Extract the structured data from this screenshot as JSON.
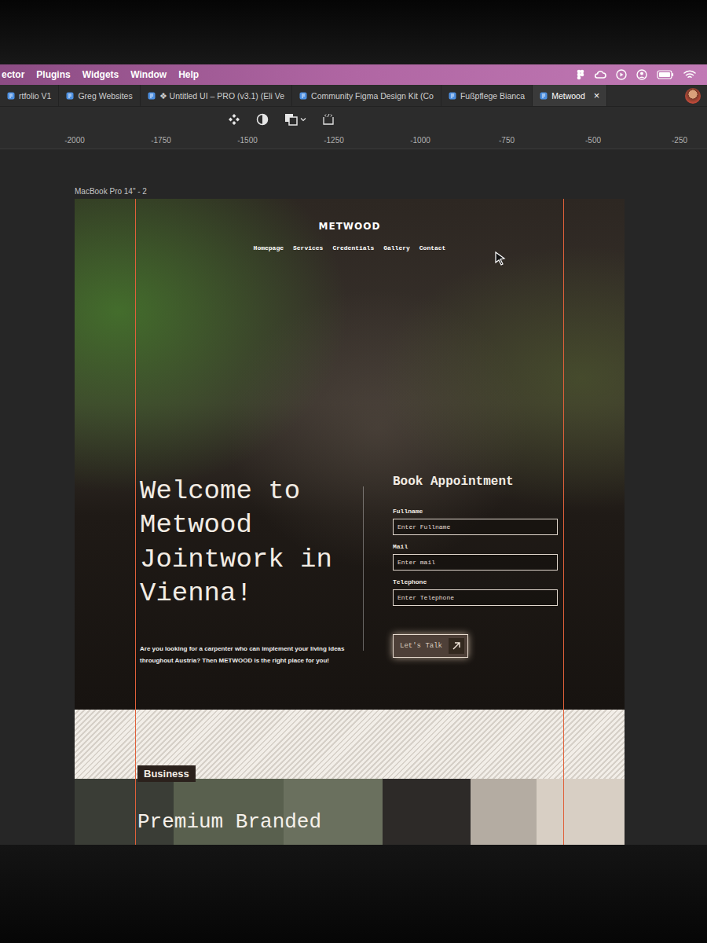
{
  "menu_bar": {
    "items": [
      "ector",
      "Plugins",
      "Widgets",
      "Window",
      "Help"
    ]
  },
  "tabs": [
    {
      "label": "rtfolio V1",
      "selected": false
    },
    {
      "label": "Greg Websites",
      "selected": false
    },
    {
      "label": "❖ Untitled UI – PRO (v3.1) (Eli Ve",
      "selected": false
    },
    {
      "label": "Community Figma Design Kit (Co",
      "selected": false
    },
    {
      "label": "Fußpflege Bianca",
      "selected": false
    },
    {
      "label": "Metwood",
      "selected": true,
      "close": "×"
    }
  ],
  "ruler": {
    "ticks": [
      "-2000",
      "-1750",
      "-1500",
      "-1250",
      "-1000",
      "-750",
      "-500",
      "-250"
    ]
  },
  "frame": {
    "label": "MacBook Pro 14\" - 2"
  },
  "site": {
    "logo": "METWOOD",
    "nav": [
      "Homepage",
      "Services",
      "Credentials",
      "Gallery",
      "Contact"
    ],
    "hero": {
      "title": "Welcome to Metwood Jointwork in Vienna!",
      "text": "Are you looking for a carpenter who can implement your living ideas throughout Austria? Then METWOOD is the right place for you!"
    },
    "form": {
      "title": "Book Appointment",
      "fields": [
        {
          "label": "Fullname",
          "placeholder": "Enter Fullname"
        },
        {
          "label": "Mail",
          "placeholder": "Enter mail"
        },
        {
          "label": "Telephone",
          "placeholder": "Enter Telephone"
        }
      ],
      "button": "Let's Talk"
    },
    "section": {
      "tag": "Business",
      "title": "Premium Branded"
    }
  }
}
